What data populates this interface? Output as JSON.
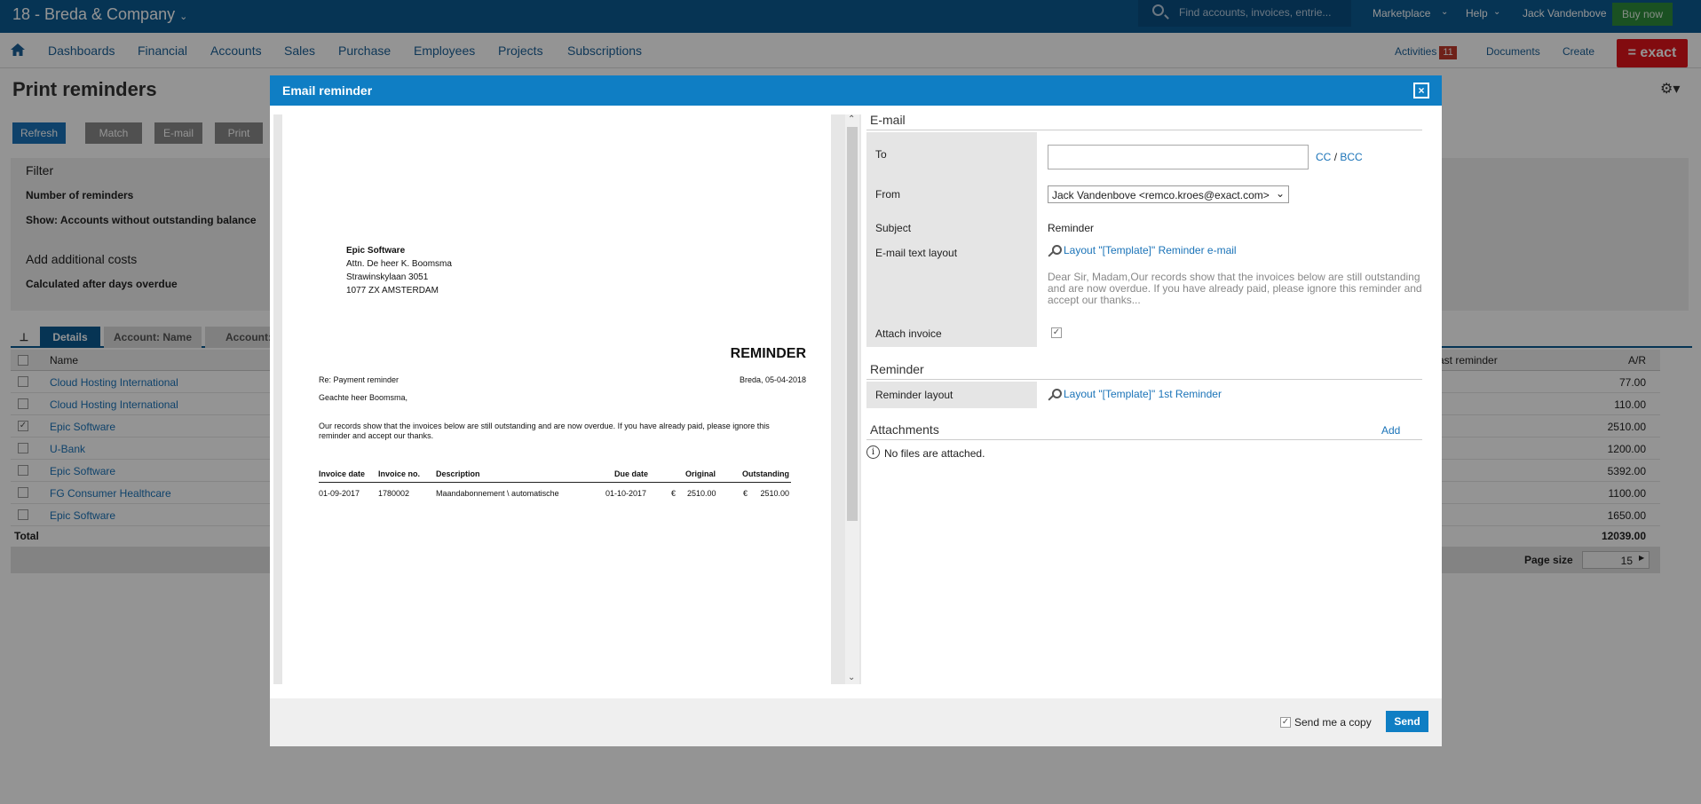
{
  "topbar": {
    "company": "18 - Breda & Company",
    "search_placeholder": "Find accounts, invoices, entrie...",
    "marketplace": "Marketplace",
    "help": "Help",
    "user": "Jack Vandenbove",
    "buy_now": "Buy now"
  },
  "nav": {
    "items": [
      "Dashboards",
      "Financial",
      "Accounts",
      "Sales",
      "Purchase",
      "Employees",
      "Projects",
      "Subscriptions"
    ],
    "activities": "Activities",
    "activities_count": "11",
    "documents": "Documents",
    "create": "Create",
    "logo": "= exact"
  },
  "page": {
    "title": "Print reminders",
    "buttons": {
      "refresh": "Refresh",
      "match": "Match",
      "email": "E-mail",
      "print": "Print"
    },
    "filter": {
      "title": "Filter",
      "number_of_reminders": "Number of reminders",
      "show": "Show: Accounts without outstanding balance",
      "additional_costs": "Add additional costs",
      "calculated": "Calculated after days overdue"
    },
    "tabs": [
      "Details",
      "Account: Name",
      "Account: C"
    ],
    "grid": {
      "col_name": "Name",
      "col_last_reminder": "ast reminder",
      "col_ar": "A/R",
      "rows": [
        {
          "name": "Cloud Hosting International",
          "ar": "77.00",
          "checked": false
        },
        {
          "name": "Cloud Hosting International",
          "ar": "110.00",
          "checked": false
        },
        {
          "name": "Epic Software",
          "ar": "2510.00",
          "checked": true
        },
        {
          "name": "U-Bank",
          "ar": "1200.00",
          "checked": false
        },
        {
          "name": "Epic Software",
          "ar": "5392.00",
          "checked": false
        },
        {
          "name": "FG Consumer Healthcare",
          "ar": "1100.00",
          "checked": false
        },
        {
          "name": "Epic Software",
          "ar": "1650.00",
          "checked": false
        }
      ],
      "total_label": "Total",
      "total_value": "12039.00",
      "page_size_label": "Page size",
      "page_size": "15"
    }
  },
  "modal": {
    "title": "Email reminder",
    "letter": {
      "company": "Epic Software",
      "attn": "Attn. De heer K.  Boomsma",
      "street": "Strawinskylaan 3051",
      "city": "1077 ZX  AMSTERDAM",
      "heading": "REMINDER",
      "re": "Re: Payment reminder",
      "place_date": "Breda, 05-04-2018",
      "salutation": "Geachte heer  Boomsma,",
      "body": "Our records show that the invoices below are still outstanding and are now overdue. If you have already paid, please ignore this reminder and accept our thanks.",
      "table": {
        "headers": [
          "Invoice date",
          "Invoice no.",
          "Description",
          "Due date",
          "Original",
          "Outstanding"
        ],
        "row": [
          "01-09-2017",
          "1780002",
          "Maandabonnement \\ automatische",
          "01-10-2017",
          "€",
          "2510.00",
          "€",
          "2510.00"
        ]
      }
    },
    "email_section": "E-mail",
    "to_label": "To",
    "to_value": "",
    "cc": "CC",
    "slash": "/",
    "bcc": "BCC",
    "from_label": "From",
    "from_value": "Jack Vandenbove <remco.kroes@exact.com>",
    "subject_label": "Subject",
    "subject_value": "Reminder",
    "text_layout_label": "E-mail text layout",
    "text_layout_link": "Layout \"[Template]\" Reminder e-mail",
    "text_preview": "Dear Sir, Madam,Our records show that the invoices below are still outstanding and are now overdue. If you have already paid, please ignore this reminder and accept our thanks...",
    "attach_label": "Attach invoice",
    "reminder_section": "Reminder",
    "reminder_layout_label": "Reminder layout",
    "reminder_layout_link": "Layout \"[Template]\" 1st Reminder",
    "attachments_section": "Attachments",
    "add": "Add",
    "no_files": "No files are attached.",
    "send_copy": "Send me a copy",
    "send": "Send"
  }
}
